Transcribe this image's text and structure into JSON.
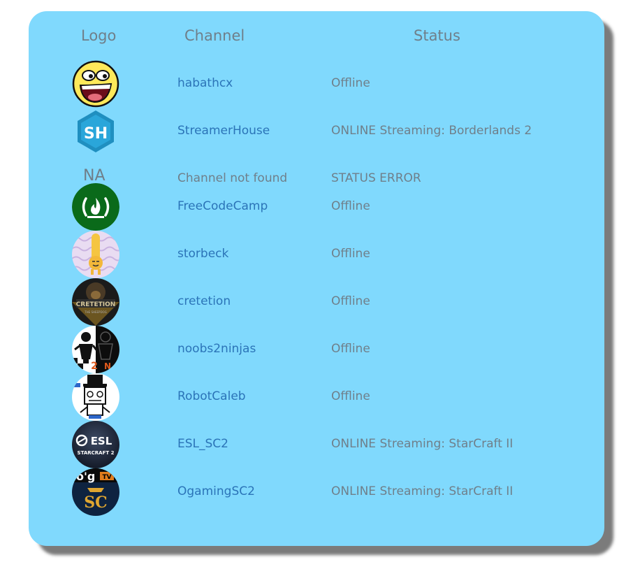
{
  "table": {
    "headers": {
      "logo": "Logo",
      "channel": "Channel",
      "status": "Status"
    },
    "rows": [
      {
        "icon": "awesome-smiley-icon",
        "channel": "habathcx",
        "status": "Offline"
      },
      {
        "icon": "streamerhouse-logo-icon",
        "channel": "StreamerHouse",
        "status": "ONLINE Streaming: Borderlands 2"
      },
      {
        "logo_text": "NA",
        "channel": "Channel not found",
        "status": "STATUS ERROR"
      },
      {
        "icon": "freecodecamp-logo-icon",
        "channel": "FreeCodeCamp",
        "status": "Offline"
      },
      {
        "icon": "storbeck-avatar-icon",
        "channel": "storbeck",
        "status": "Offline"
      },
      {
        "icon": "cretetion-avatar-icon",
        "channel": "cretetion",
        "status": "Offline"
      },
      {
        "icon": "noobs2ninjas-avatar-icon",
        "channel": "noobs2ninjas",
        "status": "Offline"
      },
      {
        "icon": "robotcaleb-avatar-icon",
        "channel": "RobotCaleb",
        "status": "Offline"
      },
      {
        "icon": "esl-sc2-logo-icon",
        "channel": "ESL_SC2",
        "status": "ONLINE Streaming: StarCraft II"
      },
      {
        "icon": "ogamingsc2-logo-icon",
        "channel": "OgamingSC2",
        "status": "ONLINE Streaming: StarCraft II"
      }
    ]
  },
  "colors": {
    "card_background": "#80d9fd",
    "link": "#2b74b8",
    "muted_text": "#6f7f8a"
  }
}
